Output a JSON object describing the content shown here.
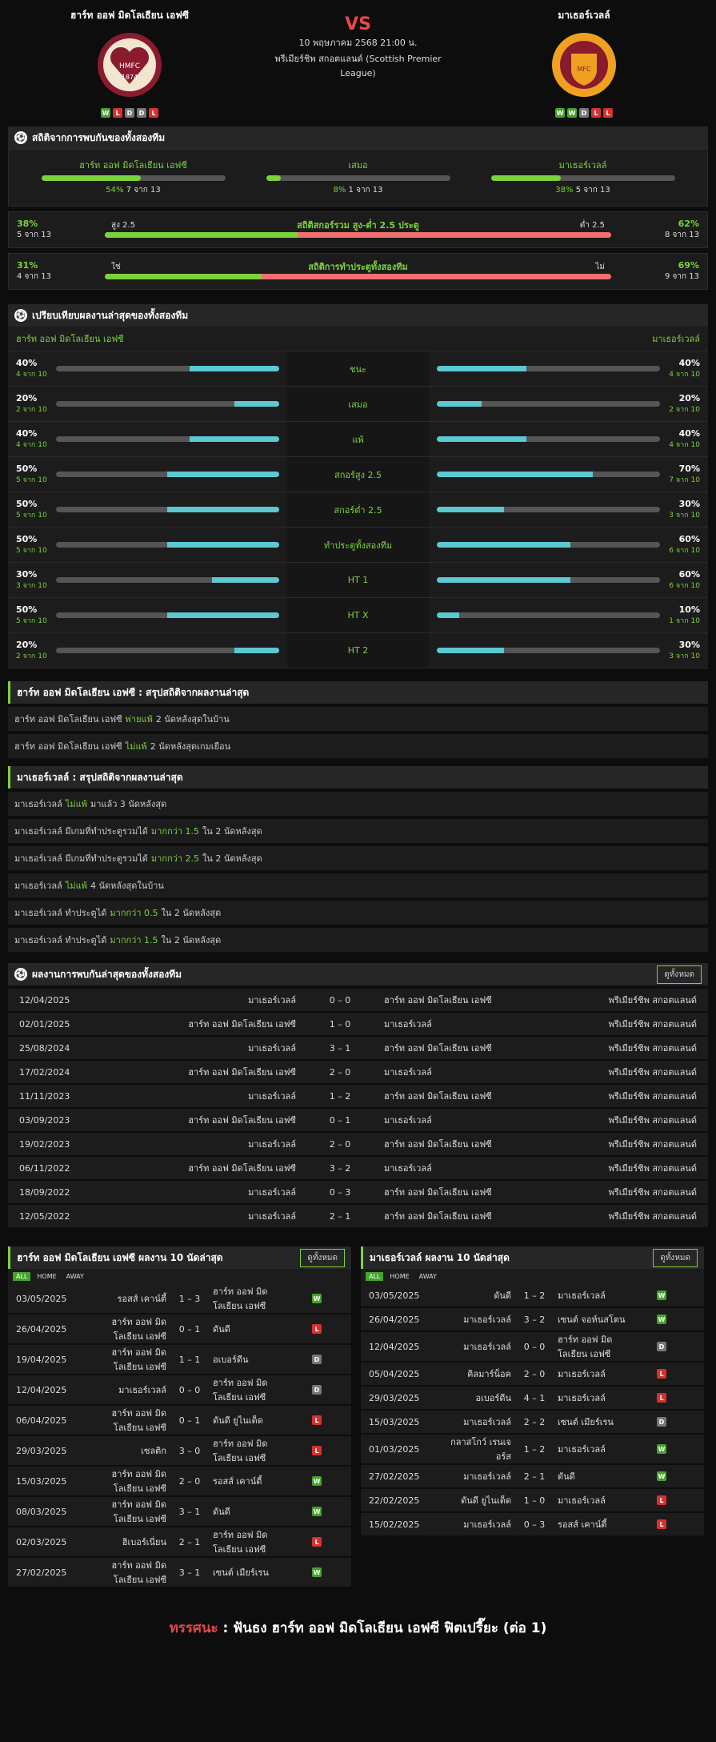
{
  "match": {
    "home": "ฮาร์ท ออฟ มิดโลเธียน เอฟซี",
    "away": "มาเธอร์เวลล์",
    "vs": "VS",
    "date": "10 พฤษภาคม 2568 21:00 น.",
    "league": "พรีเมียร์ชิพ สกอตแลนด์ (Scottish Premier League)",
    "home_form": [
      "W",
      "L",
      "D",
      "D",
      "L"
    ],
    "away_form": [
      "W",
      "W",
      "D",
      "L",
      "L"
    ],
    "home_crest_text": "H M F C 1874",
    "away_crest_text": "MOTHERWELL F.C. EST. 1886"
  },
  "h2h": {
    "title": "สถิติจากการพบกันของทั้งสองทีม",
    "items": [
      {
        "label": "ฮาร์ท ออฟ มิดโลเธียน เอฟซี",
        "pct": "54%",
        "pct_value": 54,
        "count": "7 จาก 13"
      },
      {
        "label": "เสมอ",
        "pct": "8%",
        "pct_value": 8,
        "count": "1 จาก 13"
      },
      {
        "label": "มาเธอร์เวลล์",
        "pct": "38%",
        "pct_value": 38,
        "count": "5 จาก 13"
      }
    ]
  },
  "ou": [
    {
      "label": "สถิติสกอร์รวม สูง-ต่ำ 2.5 ประตู",
      "lp": "38%",
      "lc": "5 จาก 13",
      "ll": "สูง 2.5",
      "rl": "ต่ำ 2.5",
      "rp": "62%",
      "rc": "8 จาก 13",
      "v": 38
    },
    {
      "label": "สถิติการทำประตูทั้งสองทีม",
      "lp": "31%",
      "lc": "4 จาก 13",
      "ll": "ใช่",
      "rl": "ไม่",
      "rp": "69%",
      "rc": "9 จาก 13",
      "v": 31
    }
  ],
  "compare": {
    "title": "เปรียบเทียบผลงานล่าสุดของทั้งสองทีม",
    "home": "ฮาร์ท ออฟ มิดโลเธียน เอฟซี",
    "away": "มาเธอร์เวลล์",
    "rows": [
      {
        "label": "ชนะ",
        "hp": "40%",
        "hc": "4 จาก 10",
        "hv": 40,
        "ap": "40%",
        "ac": "4 จาก 10",
        "av": 40
      },
      {
        "label": "เสมอ",
        "hp": "20%",
        "hc": "2 จาก 10",
        "hv": 20,
        "ap": "20%",
        "ac": "2 จาก 10",
        "av": 20
      },
      {
        "label": "แพ้",
        "hp": "40%",
        "hc": "4 จาก 10",
        "hv": 40,
        "ap": "40%",
        "ac": "4 จาก 10",
        "av": 40
      },
      {
        "label": "สกอร์สูง 2.5",
        "hp": "50%",
        "hc": "5 จาก 10",
        "hv": 50,
        "ap": "70%",
        "ac": "7 จาก 10",
        "av": 70
      },
      {
        "label": "สกอร์ต่ำ 2.5",
        "hp": "50%",
        "hc": "5 จาก 10",
        "hv": 50,
        "ap": "30%",
        "ac": "3 จาก 10",
        "av": 30
      },
      {
        "label": "ทำประตูทั้งสองทีม",
        "hp": "50%",
        "hc": "5 จาก 10",
        "hv": 50,
        "ap": "60%",
        "ac": "6 จาก 10",
        "av": 60
      },
      {
        "label": "HT 1",
        "hp": "30%",
        "hc": "3 จาก 10",
        "hv": 30,
        "ap": "60%",
        "ac": "6 จาก 10",
        "av": 60
      },
      {
        "label": "HT X",
        "hp": "50%",
        "hc": "5 จาก 10",
        "hv": 50,
        "ap": "10%",
        "ac": "1 จาก 10",
        "av": 10
      },
      {
        "label": "HT 2",
        "hp": "20%",
        "hc": "2 จาก 10",
        "hv": 20,
        "ap": "30%",
        "ac": "3 จาก 10",
        "av": 30
      }
    ]
  },
  "home_summary": {
    "title": "ฮาร์ท ออฟ มิดโลเธียน เอฟซี : สรุปสถิติจากผลงานล่าสุด",
    "rows": [
      [
        "ฮาร์ท ออฟ มิดโลเธียน เอฟซี",
        "พ่ายแพ้",
        "2  นัดหลังสุดในบ้าน"
      ],
      [
        "ฮาร์ท ออฟ มิดโลเธียน เอฟซี",
        "ไม่แพ้",
        "2  นัดหลังสุดเกมเยือน"
      ]
    ]
  },
  "away_summary": {
    "title": "มาเธอร์เวลล์ : สรุปสถิติจากผลงานล่าสุด",
    "rows": [
      [
        "มาเธอร์เวลล์",
        "ไม่แพ้",
        "มาแล้ว 3 นัดหลังสุด"
      ],
      [
        "มาเธอร์เวลล์  มีเกมที่ทำประตูรวมได้",
        "มากกว่า  1.5",
        "ใน 2 นัดหลังสุด"
      ],
      [
        "มาเธอร์เวลล์  มีเกมที่ทำประตูรวมได้",
        "มากกว่า  2.5",
        "ใน 2 นัดหลังสุด"
      ],
      [
        "มาเธอร์เวลล์",
        "ไม่แพ้",
        "4  นัดหลังสุดในบ้าน"
      ],
      [
        "มาเธอร์เวลล์  ทำประตูได้",
        "มากกว่า  0.5",
        "ใน 2 นัดหลังสุด"
      ],
      [
        "มาเธอร์เวลล์  ทำประตูได้",
        "มากกว่า  1.5",
        "ใน 2 นัดหลังสุด"
      ]
    ]
  },
  "meetings": {
    "title": "ผลงานการพบกันล่าสุดของทั้งสองทีม",
    "btn": "ดูทั้งหมด",
    "rows": [
      [
        "12/04/2025",
        "มาเธอร์เวลล์",
        "0 – 0",
        "ฮาร์ท ออฟ มิดโลเธียน เอฟซี",
        "พรีเมียร์ชิพ สกอตแลนด์"
      ],
      [
        "02/01/2025",
        "ฮาร์ท ออฟ มิดโลเธียน เอฟซี",
        "1 – 0",
        "มาเธอร์เวลล์",
        "พรีเมียร์ชิพ สกอตแลนด์"
      ],
      [
        "25/08/2024",
        "มาเธอร์เวลล์",
        "3 – 1",
        "ฮาร์ท ออฟ มิดโลเธียน เอฟซี",
        "พรีเมียร์ชิพ สกอตแลนด์"
      ],
      [
        "17/02/2024",
        "ฮาร์ท ออฟ มิดโลเธียน เอฟซี",
        "2 – 0",
        "มาเธอร์เวลล์",
        "พรีเมียร์ชิพ สกอตแลนด์"
      ],
      [
        "11/11/2023",
        "มาเธอร์เวลล์",
        "1 – 2",
        "ฮาร์ท ออฟ มิดโลเธียน เอฟซี",
        "พรีเมียร์ชิพ สกอตแลนด์"
      ],
      [
        "03/09/2023",
        "ฮาร์ท ออฟ มิดโลเธียน เอฟซี",
        "0 – 1",
        "มาเธอร์เวลล์",
        "พรีเมียร์ชิพ สกอตแลนด์"
      ],
      [
        "19/02/2023",
        "มาเธอร์เวลล์",
        "2 – 0",
        "ฮาร์ท ออฟ มิดโลเธียน เอฟซี",
        "พรีเมียร์ชิพ สกอตแลนด์"
      ],
      [
        "06/11/2022",
        "ฮาร์ท ออฟ มิดโลเธียน เอฟซี",
        "3 – 2",
        "มาเธอร์เวลล์",
        "พรีเมียร์ชิพ สกอตแลนด์"
      ],
      [
        "18/09/2022",
        "มาเธอร์เวลล์",
        "0 – 3",
        "ฮาร์ท ออฟ มิดโลเธียน เอฟซี",
        "พรีเมียร์ชิพ สกอตแลนด์"
      ],
      [
        "12/05/2022",
        "มาเธอร์เวลล์",
        "2 – 1",
        "ฮาร์ท ออฟ มิดโลเธียน เอฟซี",
        "พรีเมียร์ชิพ สกอตแลนด์"
      ]
    ]
  },
  "home_last10": {
    "title": "ฮาร์ท ออฟ มิดโลเธียน เอฟซี ผลงาน 10 นัดล่าสุด",
    "btn": "ดูทั้งหมด",
    "tabs": [
      "ALL",
      "HOME",
      "AWAY"
    ],
    "rows": [
      [
        "03/05/2025",
        "รอสส์ เคาน์ตี้",
        "1 – 3",
        "ฮาร์ท ออฟ มิด โลเธียน เอฟซี",
        "W"
      ],
      [
        "26/04/2025",
        "ฮาร์ท ออฟ มิด โลเธียน เอฟซี",
        "0 – 1",
        "ดันดี",
        "L"
      ],
      [
        "19/04/2025",
        "ฮาร์ท ออฟ มิด โลเธียน เอฟซี",
        "1 – 1",
        "อเบอร์ดีน",
        "D"
      ],
      [
        "12/04/2025",
        "มาเธอร์เวลล์",
        "0 – 0",
        "ฮาร์ท ออฟ มิด โลเธียน เอฟซี",
        "D"
      ],
      [
        "06/04/2025",
        "ฮาร์ท ออฟ มิด โลเธียน เอฟซี",
        "0 – 1",
        "ดันดี ยูไนเต็ด",
        "L"
      ],
      [
        "29/03/2025",
        "เซลติก",
        "3 – 0",
        "ฮาร์ท ออฟ มิด โลเธียน เอฟซี",
        "L"
      ],
      [
        "15/03/2025",
        "ฮาร์ท ออฟ มิด โลเธียน เอฟซี",
        "2 – 0",
        "รอสส์ เคาน์ตี้",
        "W"
      ],
      [
        "08/03/2025",
        "ฮาร์ท ออฟ มิด โลเธียน เอฟซี",
        "3 – 1",
        "ดันดี",
        "W"
      ],
      [
        "02/03/2025",
        "ฮิเบอร์เนี่ยน",
        "2 – 1",
        "ฮาร์ท ออฟ มิด โลเธียน เอฟซี",
        "L"
      ],
      [
        "27/02/2025",
        "ฮาร์ท ออฟ มิด โลเธียน เอฟซี",
        "3 – 1",
        "เซนต์ เมียร์เรน",
        "W"
      ]
    ]
  },
  "away_last10": {
    "title": "มาเธอร์เวลล์ ผลงาน 10 นัดล่าสุด",
    "btn": "ดูทั้งหมด",
    "tabs": [
      "ALL",
      "HOME",
      "AWAY"
    ],
    "rows": [
      [
        "03/05/2025",
        "ดันดี",
        "1 – 2",
        "มาเธอร์เวลล์",
        "W"
      ],
      [
        "26/04/2025",
        "มาเธอร์เวลล์",
        "3 – 2",
        "เซนต์ จอห์นสโตน",
        "W"
      ],
      [
        "12/04/2025",
        "มาเธอร์เวลล์",
        "0 – 0",
        "ฮาร์ท ออฟ มิด โลเธียน เอฟซี",
        "D"
      ],
      [
        "05/04/2025",
        "คิลมาร์น็อค",
        "2 – 0",
        "มาเธอร์เวลล์",
        "L"
      ],
      [
        "29/03/2025",
        "อเบอร์ดีน",
        "4 – 1",
        "มาเธอร์เวลล์",
        "L"
      ],
      [
        "15/03/2025",
        "มาเธอร์เวลล์",
        "2 – 2",
        "เซนต์ เมียร์เรน",
        "D"
      ],
      [
        "01/03/2025",
        "กลาสโกว์ เรนเจอร์ส",
        "1 – 2",
        "มาเธอร์เวลล์",
        "W"
      ],
      [
        "27/02/2025",
        "มาเธอร์เวลล์",
        "2 – 1",
        "ดันดี",
        "W"
      ],
      [
        "22/02/2025",
        "ดันดี ยูไนเต็ด",
        "1 – 0",
        "มาเธอร์เวลล์",
        "L"
      ],
      [
        "15/02/2025",
        "มาเธอร์เวลล์",
        "0 – 3",
        "รอสส์ เคาน์ตี้",
        "L"
      ]
    ]
  },
  "verdict": {
    "label": "ทรรศนะ",
    "sep": " : ",
    "text": "ฟันธง ฮาร์ท ออฟ มิดโลเธียน เอฟซี ฟิตเปรี๊ยะ (ต่อ 1)"
  }
}
